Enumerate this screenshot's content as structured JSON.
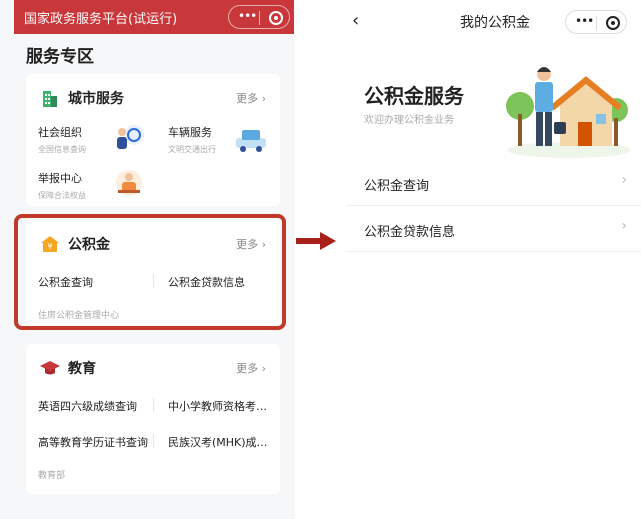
{
  "left": {
    "topbar_title": "国家政务服务平台(试运行)",
    "section_title": "服务专区",
    "city": {
      "title": "城市服务",
      "more": "更多",
      "items": [
        {
          "title": "社会组织",
          "sub": "全国信息查询"
        },
        {
          "title": "车辆服务",
          "sub": "文明交通出行"
        },
        {
          "title": "举报中心",
          "sub": "保障合法权益"
        }
      ]
    },
    "fund": {
      "title": "公积金",
      "more": "更多",
      "items": [
        "公积金查询",
        "公积金贷款信息"
      ],
      "footer": "住房公积金管理中心"
    },
    "edu": {
      "title": "教育",
      "more": "更多",
      "items": [
        "英语四六级成绩查询",
        "中小学教师资格考…",
        "高等教育学历证书查询",
        "民族汉考(MHK)成…"
      ],
      "footer": "教育部"
    }
  },
  "right": {
    "nav_title": "我的公积金",
    "hero_title": "公积金服务",
    "hero_sub": "欢迎办理公积金业务",
    "items": [
      "公积金查询",
      "公积金贷款信息"
    ]
  },
  "colors": {
    "brand_red": "#c8373a",
    "highlight": "#c0392b",
    "green": "#3cb371"
  },
  "icons": [
    "more-dots-icon",
    "target-icon",
    "chevron-right-icon",
    "back-icon",
    "building-icon",
    "coin-house-icon",
    "graduation-cap-icon"
  ]
}
